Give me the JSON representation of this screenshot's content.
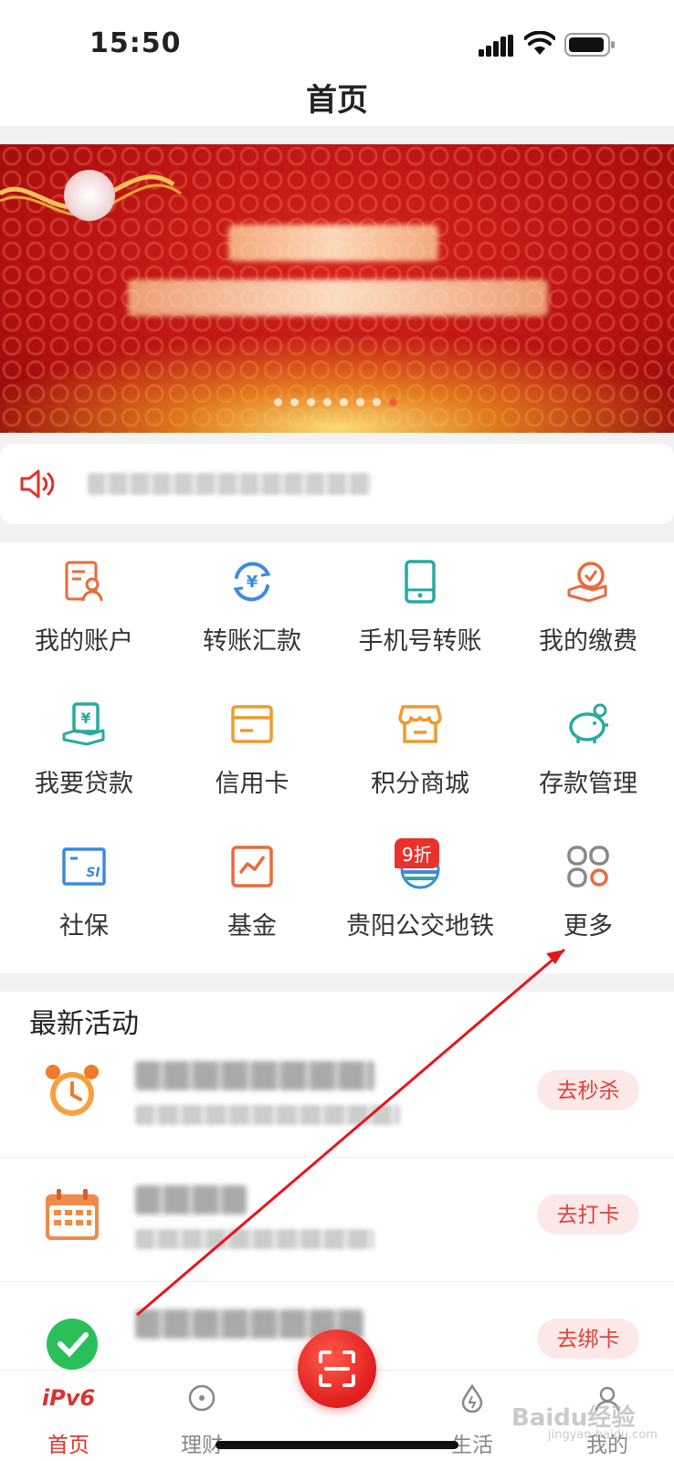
{
  "status_bar": {
    "time": "15:50"
  },
  "nav": {
    "title": "首页"
  },
  "banner": {
    "dot_count": 8,
    "active_dot": 7
  },
  "grid": {
    "items": [
      {
        "label": "我的账户",
        "icon": "account-icon",
        "color": "#ea6a3a"
      },
      {
        "label": "转账汇款",
        "icon": "transfer-icon",
        "color": "#3b8be0"
      },
      {
        "label": "手机号转账",
        "icon": "phone-transfer-icon",
        "color": "#2aa9a0"
      },
      {
        "label": "我的缴费",
        "icon": "payment-icon",
        "color": "#ea6a3a"
      },
      {
        "label": "我要贷款",
        "icon": "loan-icon",
        "color": "#2aa9a0"
      },
      {
        "label": "信用卡",
        "icon": "credit-card-icon",
        "color": "#f09a2c"
      },
      {
        "label": "积分商城",
        "icon": "shop-icon",
        "color": "#f09a2c"
      },
      {
        "label": "存款管理",
        "icon": "piggy-bank-icon",
        "color": "#2aa9a0"
      },
      {
        "label": "社保",
        "icon": "social-security-icon",
        "color": "#3b8be0"
      },
      {
        "label": "基金",
        "icon": "fund-icon",
        "color": "#ea6a3a"
      },
      {
        "label": "贵阳公交地铁",
        "icon": "transit-icon",
        "color": "#3b8be0",
        "badge": "9折"
      },
      {
        "label": "更多",
        "icon": "more-icon",
        "color": "#888888"
      }
    ]
  },
  "activities": {
    "title": "最新活动",
    "rows": [
      {
        "icon": "alarm-clock-icon",
        "button": "去秒杀"
      },
      {
        "icon": "calendar-icon",
        "button": "去打卡"
      },
      {
        "icon": "check-icon",
        "button": "去绑卡"
      }
    ]
  },
  "tabs": [
    {
      "label": "首页",
      "icon_text": "iPv6",
      "active": true
    },
    {
      "label": "理财",
      "active": false
    },
    {
      "label": "生活",
      "active": false
    },
    {
      "label": "我的",
      "active": false
    }
  ],
  "watermark": {
    "text": "Baidu经验",
    "sub": "jingyan.baidu.com"
  },
  "colors": {
    "brand_red": "#e0302a",
    "banner_red": "#b81414"
  }
}
